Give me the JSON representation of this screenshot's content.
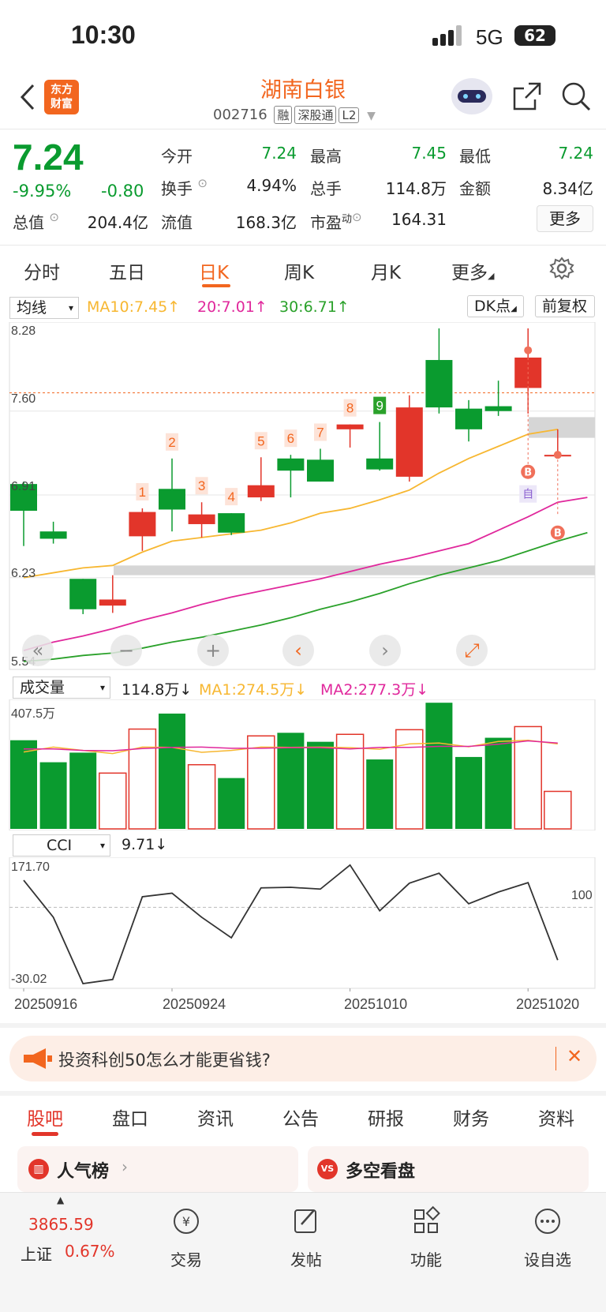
{
  "status": {
    "time": "10:30",
    "network": "5G",
    "battery": "62"
  },
  "header": {
    "logo_text_1": "东方",
    "logo_text_2": "财富",
    "stock_name": "湖南白银",
    "stock_code": "002716",
    "tags": [
      "融",
      "深股通",
      "L2"
    ]
  },
  "quote": {
    "price": "7.24",
    "change_pct": "-9.95%",
    "change_amt": "-0.80",
    "open_label": "今开",
    "open": "7.24",
    "high_label": "最高",
    "high": "7.45",
    "low_label": "最低",
    "low": "7.24",
    "turnover_label": "换手",
    "turnover": "4.94%",
    "volume_label": "总手",
    "volume": "114.8万",
    "amount_label": "金额",
    "amount": "8.34亿",
    "mktcap_label": "总值",
    "mktcap": "204.4亿",
    "float_label": "流值",
    "float_cap": "168.3亿",
    "pe_label": "市盈",
    "pe_sup": "动",
    "pe": "164.31",
    "more_label": "更多"
  },
  "period_tabs": [
    "分时",
    "五日",
    "日K",
    "周K",
    "月K",
    "更多"
  ],
  "active_period": "日K",
  "kline": {
    "ma_select": "均线",
    "ma10": "MA10:7.45",
    "ma20": "20:7.01",
    "ma30": "30:6.71",
    "dk_label": "DK点",
    "adjust_label": "前复权",
    "y_ticks": [
      "8.28",
      "7.60",
      "6.91",
      "6.23",
      "5.54"
    ],
    "count_labels": [
      "1",
      "2",
      "3",
      "4",
      "5",
      "6",
      "7",
      "8",
      "9"
    ],
    "signal_b": "B",
    "signal_self": "自",
    "colors": {
      "up": "#e2352a",
      "down": "#0a9b2f",
      "ma10": "#f7b731",
      "ma20": "#e0289c",
      "ma30": "#2aa12a"
    }
  },
  "volume": {
    "select": "成交量",
    "value": "114.8万",
    "ma1": "MA1:274.5万",
    "ma2": "MA2:277.3万",
    "max_tick": "407.5万"
  },
  "cci": {
    "select": "CCI",
    "value": "9.71",
    "max_tick": "171.70",
    "min_tick": "-30.02",
    "ref_line": "100"
  },
  "dates": [
    "20250916",
    "20250924",
    "20251010",
    "20251020"
  ],
  "chart_data": {
    "type": "candlestick",
    "y_range": [
      5.54,
      8.28
    ],
    "candles": [
      {
        "o": 7.0,
        "h": 7.02,
        "l": 6.49,
        "c": 6.78
      },
      {
        "o": 6.61,
        "h": 6.69,
        "l": 6.51,
        "c": 6.55
      },
      {
        "o": 6.22,
        "h": 6.22,
        "l": 5.93,
        "c": 5.97
      },
      {
        "o": 6.0,
        "h": 6.25,
        "l": 5.94,
        "c": 6.05
      },
      {
        "o": 6.57,
        "h": 6.8,
        "l": 6.45,
        "c": 6.77
      },
      {
        "o": 6.96,
        "h": 7.21,
        "l": 6.61,
        "c": 6.79
      },
      {
        "o": 6.67,
        "h": 6.85,
        "l": 6.56,
        "c": 6.75
      },
      {
        "o": 6.76,
        "h": 6.76,
        "l": 6.58,
        "c": 6.6
      },
      {
        "o": 6.89,
        "h": 7.22,
        "l": 6.86,
        "c": 6.99
      },
      {
        "o": 7.21,
        "h": 7.24,
        "l": 6.89,
        "c": 7.11
      },
      {
        "o": 7.2,
        "h": 7.29,
        "l": 7.02,
        "c": 7.02
      },
      {
        "o": 7.45,
        "h": 7.49,
        "l": 7.3,
        "c": 7.49
      },
      {
        "o": 7.21,
        "h": 7.51,
        "l": 7.11,
        "c": 7.12
      },
      {
        "o": 7.06,
        "h": 7.73,
        "l": 7.02,
        "c": 7.63
      },
      {
        "o": 8.02,
        "h": 8.28,
        "l": 7.58,
        "c": 7.63
      },
      {
        "o": 7.62,
        "h": 7.69,
        "l": 7.35,
        "c": 7.45
      },
      {
        "o": 7.64,
        "h": 7.85,
        "l": 7.56,
        "c": 7.6
      },
      {
        "o": 7.79,
        "h": 8.28,
        "l": 7.58,
        "c": 8.04
      },
      {
        "o": 7.24,
        "h": 7.45,
        "l": 7.24,
        "c": 7.24
      }
    ],
    "ma10": [
      6.23,
      6.27,
      6.31,
      6.33,
      6.44,
      6.53,
      6.56,
      6.59,
      6.62,
      6.68,
      6.76,
      6.8,
      6.87,
      6.95,
      7.09,
      7.21,
      7.31,
      7.41,
      7.45
    ],
    "ma20": [
      5.63,
      5.7,
      5.75,
      5.81,
      5.88,
      5.94,
      6.01,
      6.07,
      6.12,
      6.17,
      6.22,
      6.28,
      6.34,
      6.39,
      6.45,
      6.51,
      6.62,
      6.73,
      6.85,
      6.89
    ],
    "ma30": [
      5.54,
      5.56,
      5.59,
      5.61,
      5.65,
      5.7,
      5.74,
      5.79,
      5.84,
      5.9,
      5.97,
      6.03,
      6.1,
      6.18,
      6.25,
      6.31,
      6.37,
      6.45,
      6.53,
      6.6
    ],
    "volume_wan": [
      286,
      215,
      246,
      180,
      322,
      372,
      207,
      164,
      300,
      310,
      281,
      305,
      224,
      320,
      407,
      232,
      294,
      330,
      121
    ],
    "volume_ma1": [
      248,
      264,
      253,
      243,
      264,
      263,
      247,
      253,
      264,
      263,
      264,
      262,
      257,
      274,
      277,
      265,
      282,
      286,
      274
    ],
    "volume_ma2": [
      258,
      258,
      253,
      252,
      259,
      263,
      264,
      260,
      260,
      262,
      262,
      258,
      263,
      263,
      266,
      266,
      273,
      284,
      277
    ],
    "cci": [
      146,
      83,
      -30,
      -23,
      118,
      124,
      83,
      48,
      133,
      134,
      131,
      172,
      94,
      141,
      158,
      106,
      126,
      142,
      10
    ]
  },
  "banner": {
    "text": "投资科创50怎么才能更省钱?"
  },
  "bottom_tabs": [
    "股吧",
    "盘口",
    "资讯",
    "公告",
    "研报",
    "财务",
    "资料"
  ],
  "cards": [
    {
      "label": "人气榜"
    },
    {
      "label": "多空看盘"
    }
  ],
  "footer": {
    "index_value": "3865.59",
    "index_name": "上证",
    "index_change": "0.67%",
    "items": [
      "交易",
      "发帖",
      "功能",
      "设自选"
    ]
  }
}
